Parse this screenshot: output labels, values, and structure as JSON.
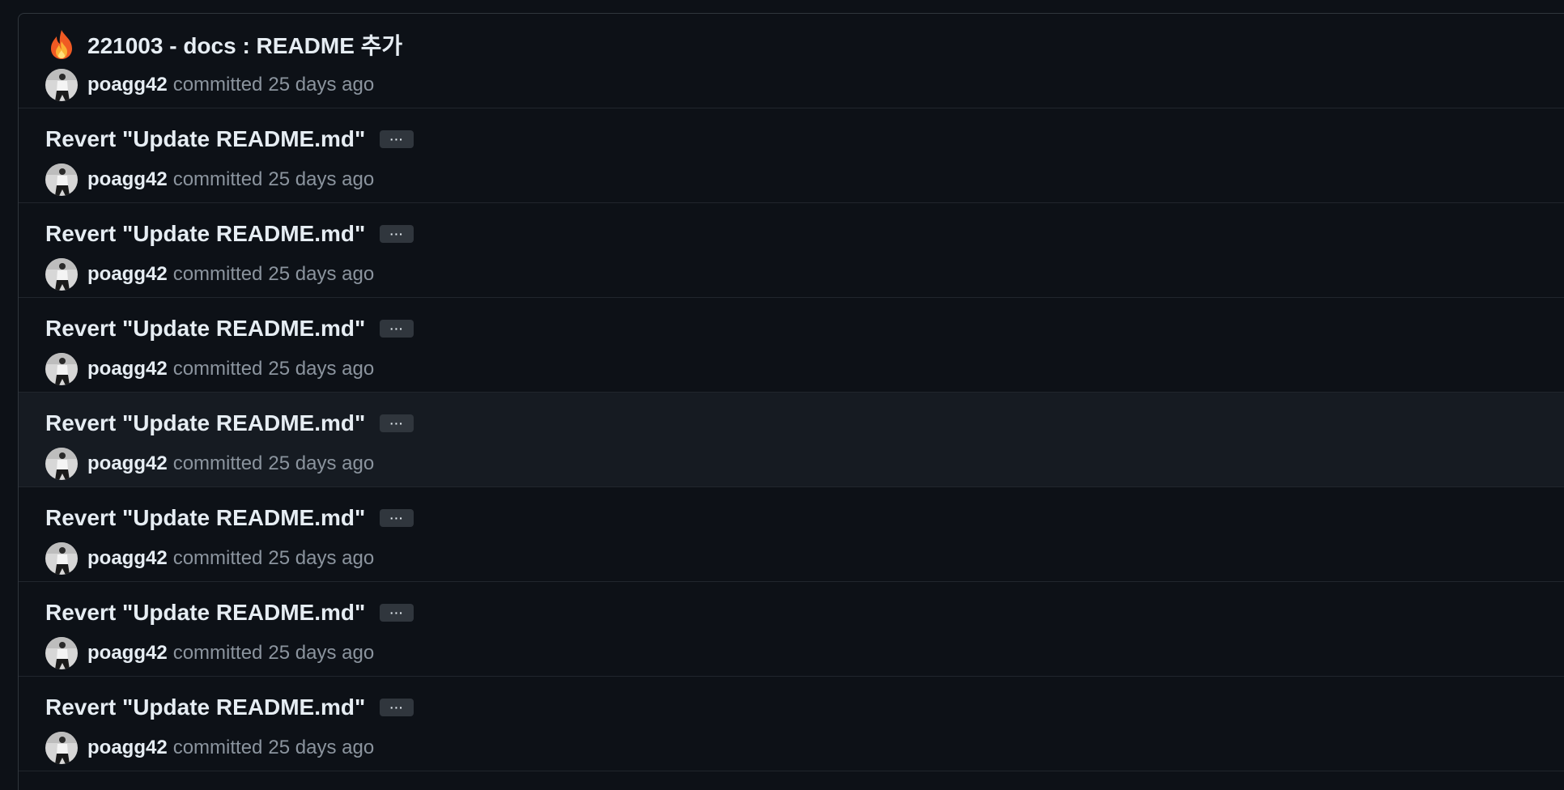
{
  "commits": [
    {
      "emoji": "fire-icon",
      "message": "221003 - docs : README 추가",
      "author": "poagg42",
      "action": "committed",
      "time": "25 days ago",
      "has_ellipsis": false,
      "hovered": false
    },
    {
      "message": "Revert \"Update README.md\"",
      "ellipsis_label": "···",
      "author": "poagg42",
      "action": "committed",
      "time": "25 days ago",
      "has_ellipsis": true,
      "hovered": false
    },
    {
      "message": "Revert \"Update README.md\"",
      "ellipsis_label": "···",
      "author": "poagg42",
      "action": "committed",
      "time": "25 days ago",
      "has_ellipsis": true,
      "hovered": false
    },
    {
      "message": "Revert \"Update README.md\"",
      "ellipsis_label": "···",
      "author": "poagg42",
      "action": "committed",
      "time": "25 days ago",
      "has_ellipsis": true,
      "hovered": false
    },
    {
      "message": "Revert \"Update README.md\"",
      "ellipsis_label": "···",
      "author": "poagg42",
      "action": "committed",
      "time": "25 days ago",
      "has_ellipsis": true,
      "hovered": true
    },
    {
      "message": "Revert \"Update README.md\"",
      "ellipsis_label": "···",
      "author": "poagg42",
      "action": "committed",
      "time": "25 days ago",
      "has_ellipsis": true,
      "hovered": false
    },
    {
      "message": "Revert \"Update README.md\"",
      "ellipsis_label": "···",
      "author": "poagg42",
      "action": "committed",
      "time": "25 days ago",
      "has_ellipsis": true,
      "hovered": false
    },
    {
      "message": "Revert \"Update README.md\"",
      "ellipsis_label": "···",
      "author": "poagg42",
      "action": "committed",
      "time": "25 days ago",
      "has_ellipsis": true,
      "hovered": false
    }
  ],
  "colors": {
    "background": "#0d1117",
    "row_hover": "#161b22",
    "border": "#30363d",
    "text_primary": "#e6edf3",
    "text_muted": "#8b949e"
  }
}
